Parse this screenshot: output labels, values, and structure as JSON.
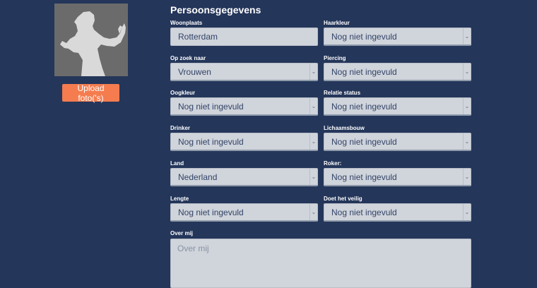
{
  "profile": {
    "upload_label": "Upload foto('s)"
  },
  "form": {
    "title": "Persoonsgegevens",
    "fields": [
      {
        "label": "Woonplaats",
        "value": "Rotterdam"
      },
      {
        "label": "Haarkleur",
        "value": "Nog niet ingevuld"
      },
      {
        "label": "Op zoek naar",
        "value": "Vrouwen"
      },
      {
        "label": "Piercing",
        "value": "Nog niet ingevuld"
      },
      {
        "label": "Oogkleur",
        "value": "Nog niet ingevuld"
      },
      {
        "label": "Relatie status",
        "value": "Nog niet ingevuld"
      },
      {
        "label": "Drinker",
        "value": "Nog niet ingevuld"
      },
      {
        "label": "Lichaamsbouw",
        "value": "Nog niet ingevuld"
      },
      {
        "label": "Land",
        "value": "Nederland"
      },
      {
        "label": "Roker:",
        "value": "Nog niet ingevuld"
      },
      {
        "label": "Lengte",
        "value": "Nog niet ingevuld"
      },
      {
        "label": "Doet het veilig",
        "value": "Nog niet ingevuld"
      }
    ],
    "about_label": "Over mij",
    "about_placeholder": "Over mij"
  }
}
